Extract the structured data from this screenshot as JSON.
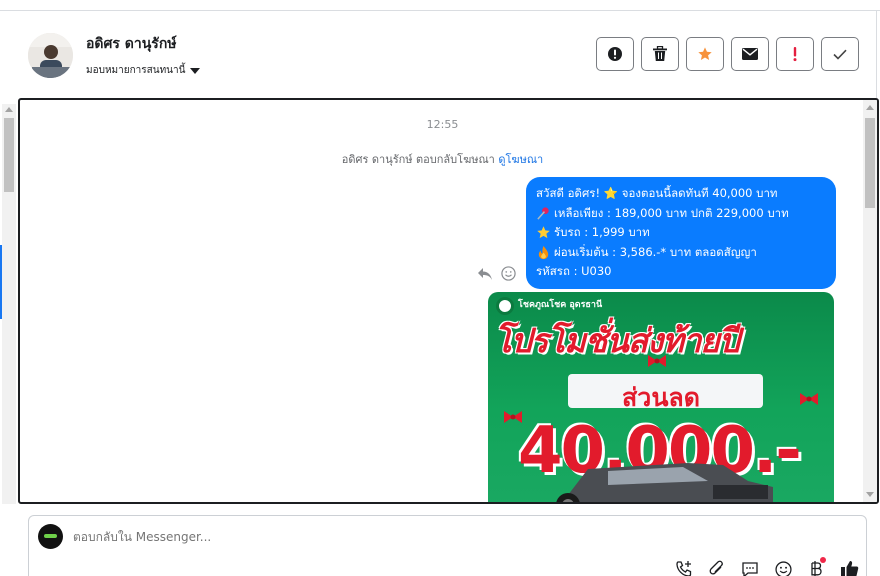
{
  "contact": {
    "name": "อดิศร ดานุรักษ์",
    "assign_label": "มอบหมายการสนทนานี้"
  },
  "header_actions": [
    {
      "name": "spam-alert",
      "icon": "alert-circle-icon"
    },
    {
      "name": "delete",
      "icon": "trash-icon"
    },
    {
      "name": "star",
      "icon": "star-icon",
      "color": "#f7923b"
    },
    {
      "name": "mark-unread",
      "icon": "envelope-icon"
    },
    {
      "name": "follow-up",
      "icon": "exclamation-icon",
      "color": "#e41e3f"
    },
    {
      "name": "mark-done",
      "icon": "check-icon"
    }
  ],
  "thread": {
    "time": "12:55",
    "system_text": "อดิศร ดานุรักษ์ ตอบกลับโฆษณา",
    "system_link": "ดูโฆษณา",
    "message_lines": [
      {
        "icon": "star-emoji",
        "text": "สวัสดี อดิศร! ⭐ จองตอนนี้ลดทันที 40,000 บาท"
      },
      {
        "icon": "pushpin-emoji",
        "text": "เหลือเพียง : 189,000 บาท ปกติ 229,000 บาท"
      },
      {
        "icon": "star-emoji",
        "text": "รับรถ : 1,999 บาท"
      },
      {
        "icon": "fire-emoji",
        "text": "ผ่อนเริ่มต้น : 3,586.-* บาท ตลอดสัญญา"
      },
      {
        "icon": "",
        "text": "รหัสรถ : U030"
      }
    ],
    "promo": {
      "brand": "โชคภูณโชค อุดรธานี",
      "headline": "โปรโมชั่นส่งท้ายปี",
      "discount_label": "ส่วนลด",
      "amount": "40,000.-"
    }
  },
  "composer": {
    "placeholder": "ตอบกลับใน Messenger..."
  },
  "colors": {
    "bubble": "#0a7cff",
    "link": "#1b74e4",
    "promo_green": "#12a45a",
    "promo_red": "#e21b2c"
  }
}
